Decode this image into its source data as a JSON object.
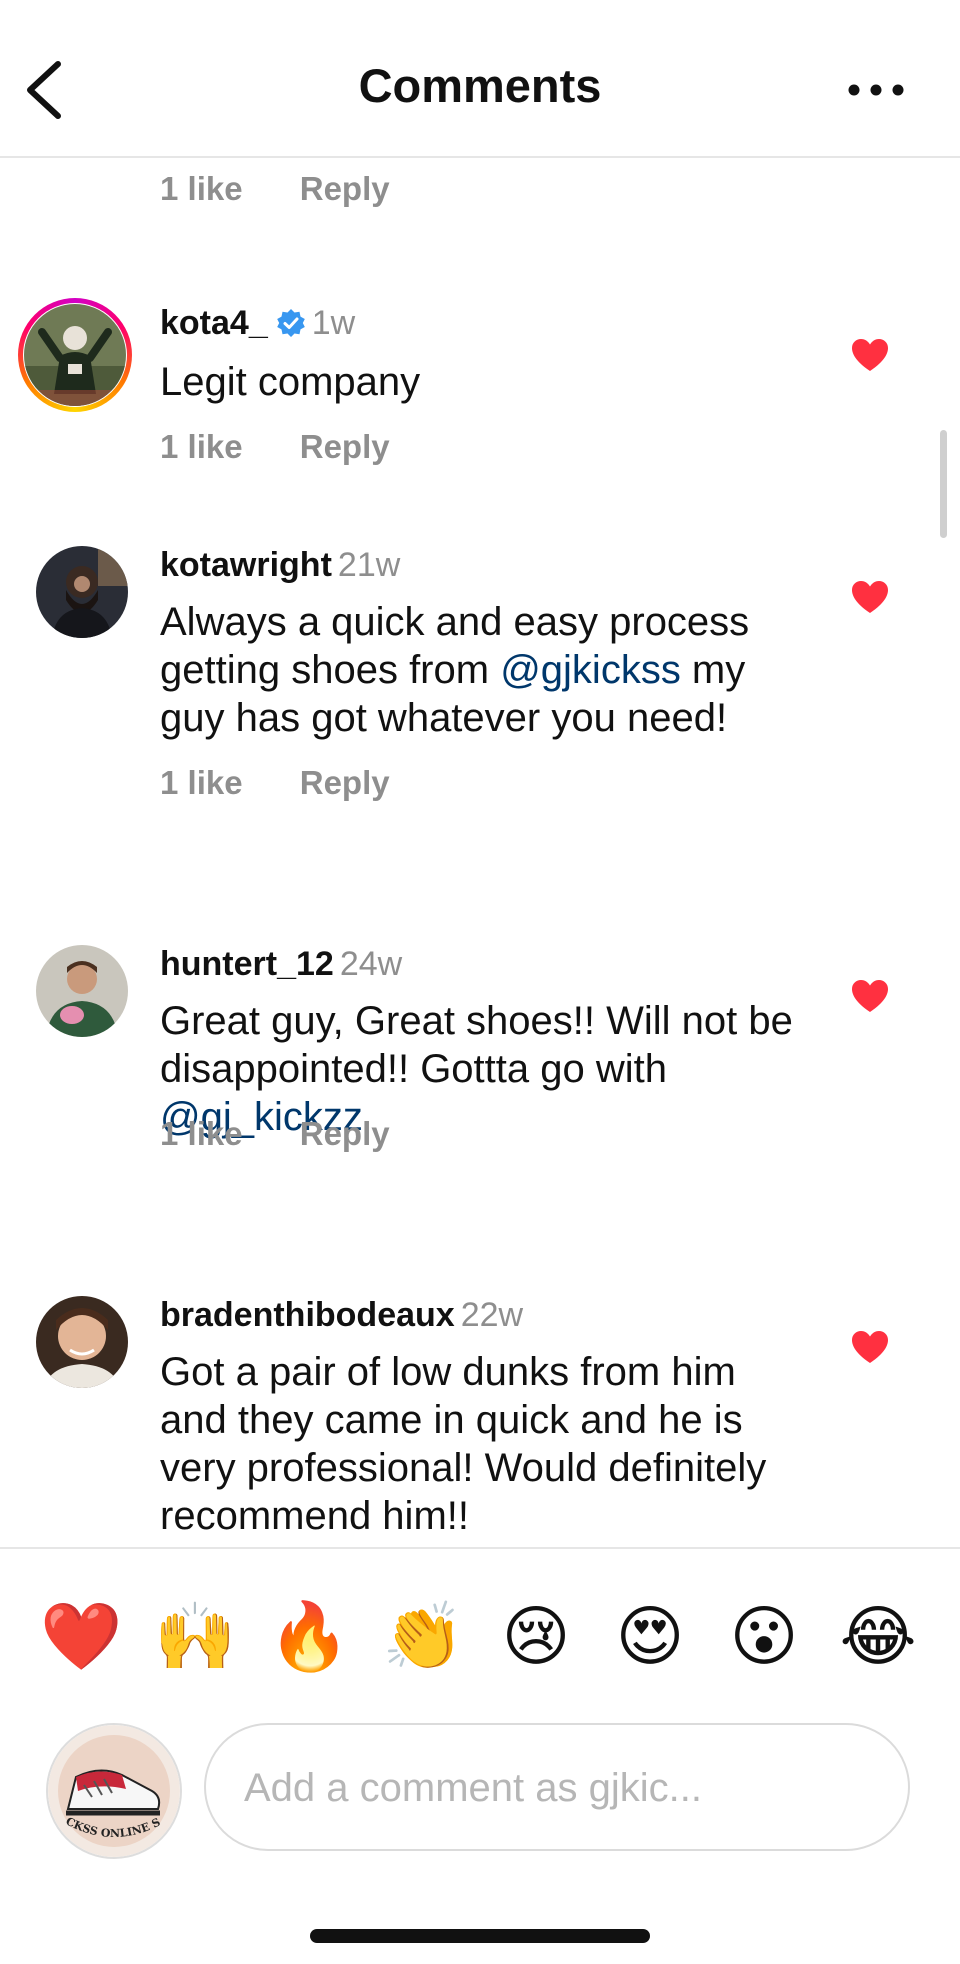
{
  "header": {
    "title": "Comments",
    "back_icon": "chevron-left-icon",
    "more_icon": "ellipsis-icon"
  },
  "previous_comment_meta": {
    "likes": "1 like",
    "reply": "Reply"
  },
  "comments": [
    {
      "username": "kota4_",
      "verified": true,
      "time": "1w",
      "text": "Legit company",
      "likes": "1 like",
      "reply": "Reply",
      "liked": true
    },
    {
      "username": "kotawright",
      "time": "21w",
      "text_before": "Always a quick and easy process getting shoes from ",
      "mention": "@gjkickss",
      "text_after": " my guy has got whatever you need!",
      "likes": "1 like",
      "reply": "Reply",
      "liked": true
    },
    {
      "username": "huntert_12",
      "time": "24w",
      "text_before": "Great guy, Great shoes!! Will not be disappointed!! Gottta go with ",
      "mention": "@gj_kickzz",
      "likes": "1 like",
      "reply": "Reply",
      "liked": true
    },
    {
      "username": "bradenthibodeaux",
      "time": "22w",
      "text": "Got a pair of low dunks from him and they came in quick and he is very professional! Would definitely recommend him!!",
      "liked": true
    }
  ],
  "emoji_bar": [
    "❤️",
    "🙌",
    "🔥",
    "👏",
    "😢",
    "😍",
    "😮",
    "😂"
  ],
  "composer": {
    "placeholder": "Add a comment as gjkic...",
    "avatar_logo_text": "GJ KICKSS ONLINE STORE"
  },
  "colors": {
    "like_red": "#ff3040",
    "mention_blue": "#00376b",
    "verified_blue": "#3897f0",
    "muted_gray": "#8e8e8e"
  }
}
